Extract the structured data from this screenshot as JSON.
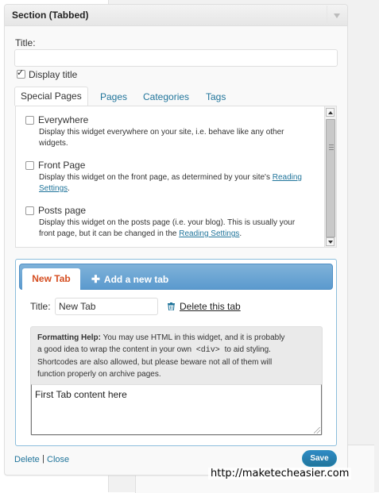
{
  "widget": {
    "title": "Section (Tabbed)",
    "title_label": "Title:",
    "title_value": "",
    "display_title_label": "Display title",
    "display_title_checked": true
  },
  "visibility_tabs": [
    "Special Pages",
    "Pages",
    "Categories",
    "Tags"
  ],
  "special_pages": [
    {
      "label": "Everywhere",
      "desc": "Display this widget everywhere on your site, i.e. behave like any other widgets.",
      "desc_line1": "Display this widget everywhere on your site, i.e. behave like any other",
      "desc_line2": "widgets.",
      "checked": false
    },
    {
      "label": "Front Page",
      "desc_line1_pre": "Display this widget on the front page, as determined by your site's ",
      "desc_link_a": "Reading",
      "desc_link_b": "Settings",
      "desc_line2_post": ".",
      "checked": false
    },
    {
      "label": "Posts page",
      "desc_line1": "Display this widget on the posts page (i.e. your blog). This is usually your",
      "desc_line2_pre": "front page, but it can be changed in the ",
      "desc_link": "Reading Settings",
      "desc_line2_post": ".",
      "checked": false
    }
  ],
  "section": {
    "active_tab": "New Tab",
    "add_tab_label": "Add a new tab",
    "tab_title_label": "Title:",
    "tab_title_value": "New Tab",
    "delete_tab_label": "Delete this tab",
    "help_heading": "Formatting Help:",
    "help_text_1": " You may use HTML in this widget, and it is probably",
    "help_text_2": "a good idea to wrap the content in your own ",
    "help_code": "<div>",
    "help_text_3": " to aid styling.",
    "help_text_4": "Shortcodes are also allowed, but please beware not all of them will",
    "help_text_5": "function properly on archive pages.",
    "content": "First Tab content here"
  },
  "footer": {
    "delete_label": "Delete",
    "separator": "|",
    "close_label": "Close",
    "save_label": "Save"
  },
  "watermark": "http://maketecheasier.com",
  "colors": {
    "link": "#21759b",
    "active_tab_text": "#d54e21",
    "tab_bar": "#5b9ace",
    "save_button": "#21759b"
  }
}
